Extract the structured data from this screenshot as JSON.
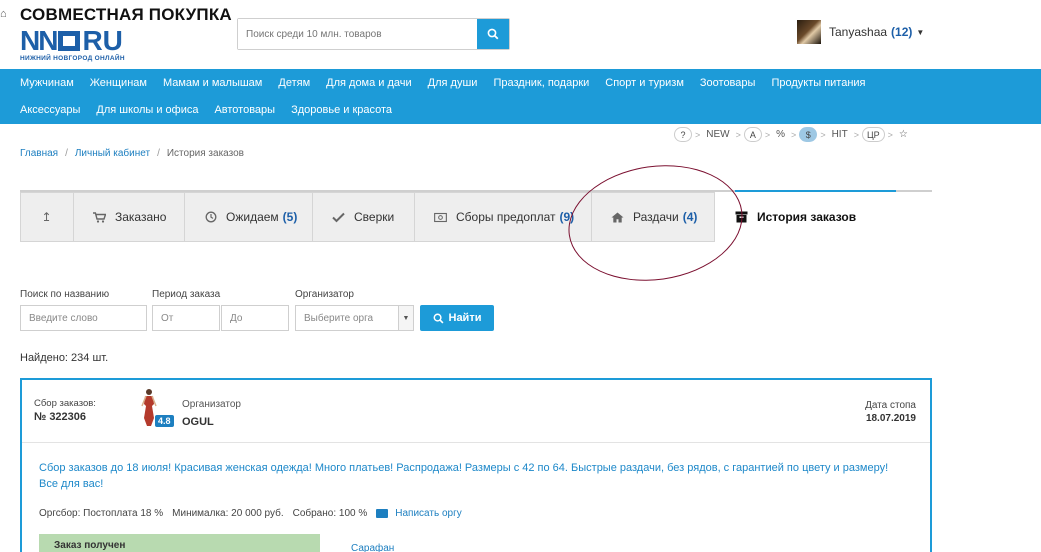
{
  "header": {
    "site_title": "СОВМЕСТНАЯ ПОКУПКА",
    "logo_main_left": "NN",
    "logo_main_right": "RU",
    "logo_sub": "НИЖНИЙ НОВГОРОД ОНЛАЙН",
    "search_placeholder": "Поиск среди 10 млн. товаров",
    "user_name": "Tanyashaa",
    "user_count": "(12)"
  },
  "nav": {
    "row1": [
      "Мужчинам",
      "Женщинам",
      "Мамам и малышам",
      "Детям",
      "Для дома и дачи",
      "Для души",
      "Праздник, подарки",
      "Спорт и туризм",
      "Зоотовары",
      "Продукты питания"
    ],
    "row2": [
      "Аксессуары",
      "Для школы и офиса",
      "Автотовары",
      "Здоровье и красота"
    ]
  },
  "filters": {
    "items": [
      "?",
      "NEW",
      "A",
      "%",
      "$",
      "HIT",
      "ЦР",
      "☆"
    ]
  },
  "breadcrumb": {
    "home": "Главная",
    "cabinet": "Личный кабинет",
    "current": "История заказов"
  },
  "tabs": [
    {
      "label": "",
      "count": "",
      "icon": "sort-arrow-icon"
    },
    {
      "label": "Заказано",
      "count": "",
      "icon": "cart-icon"
    },
    {
      "label": "Ожидаем",
      "count": "(5)",
      "icon": "clock-icon"
    },
    {
      "label": "Сверки",
      "count": "",
      "icon": "check-icon"
    },
    {
      "label": "Сборы предоплат",
      "count": "(9)",
      "icon": "money-icon"
    },
    {
      "label": "Раздачи",
      "count": "(4)",
      "icon": "home-icon"
    },
    {
      "label": "История заказов",
      "count": "",
      "icon": "archive-icon"
    }
  ],
  "form": {
    "name_label": "Поиск по названию",
    "name_placeholder": "Введите слово",
    "period_label": "Период заказа",
    "from_placeholder": "От",
    "to_placeholder": "До",
    "org_label": "Организатор",
    "org_placeholder": "Выберите орга",
    "submit": "Найти"
  },
  "found": "Найдено: 234 шт.",
  "order": {
    "label": "Сбор заказов:",
    "number": "№ 322306",
    "rating": "4.8",
    "org_label": "Организатор",
    "org_name": "OGUL",
    "stop_label": "Дата стопа",
    "stop_date": "18.07.2019",
    "description": "Сбор заказов до 18 июля! Красивая женская одежда! Много платьев! Распродажа! Размеры с 42 по 64. Быстрые раздачи, без рядов, с гарантией по цвету и размеру!Все для вас!",
    "orgsbor": "Оргсбор: Постоплата 18 %",
    "minimal": "Минималка: 20 000 руб.",
    "collected": "Собрано: 100 %",
    "write_org": "Написать оргу",
    "status": "Заказ получен",
    "item": "Сарафан"
  }
}
